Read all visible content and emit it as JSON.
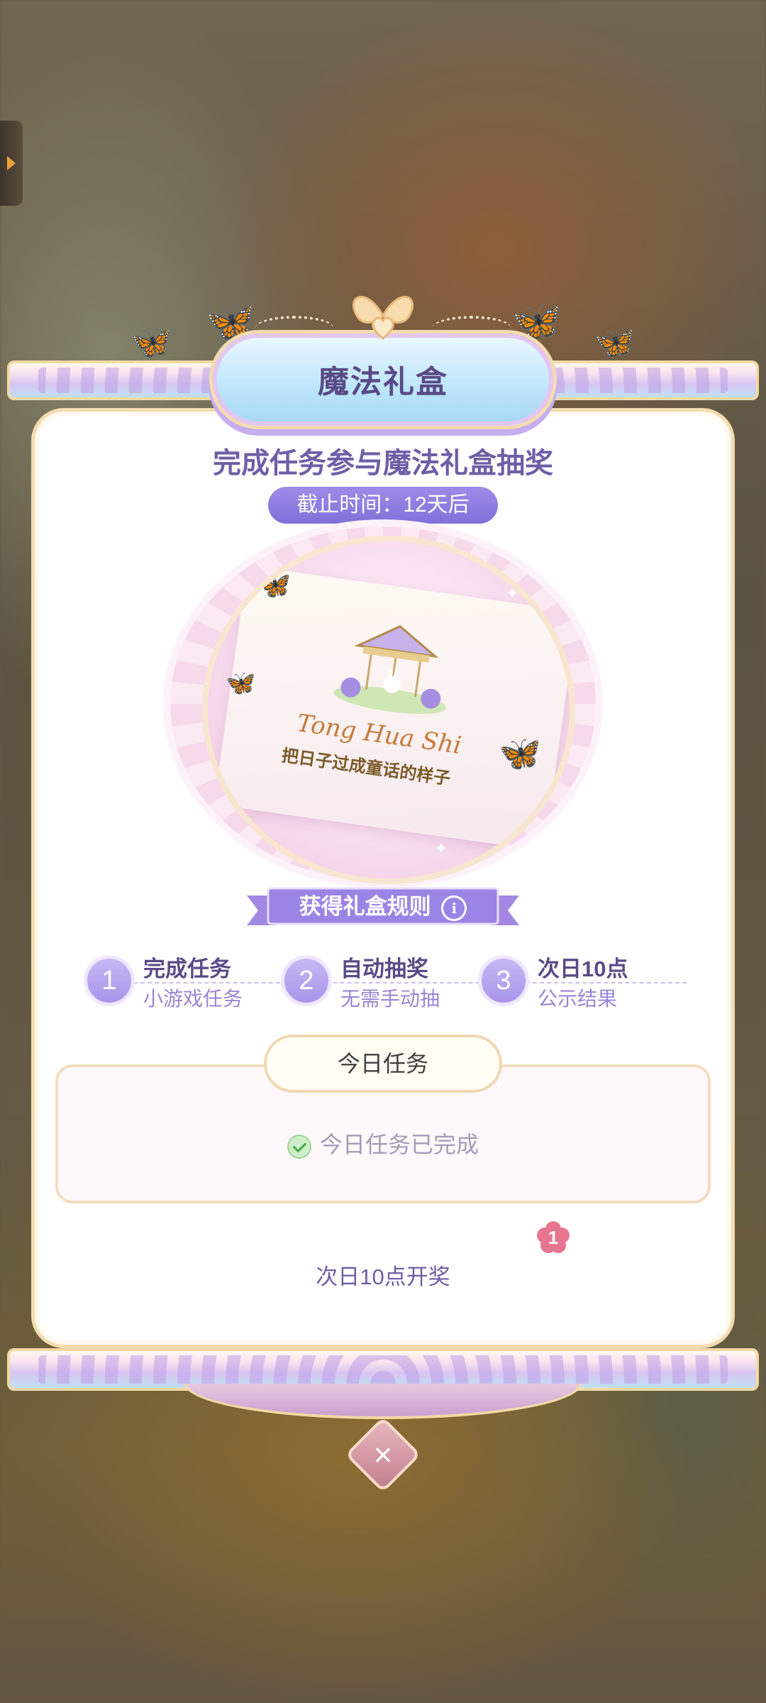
{
  "popup": {
    "title": "魔法礼盒",
    "subtitle": "完成任务参与魔法礼盒抽奖",
    "deadline": "截止时间：12天后",
    "prize": {
      "script_text": "Tong Hua Shi",
      "slogan": "把日子过成童话的样子"
    },
    "rules_label": "获得礼盒规则",
    "steps": [
      {
        "num": "1",
        "title": "完成任务",
        "subtitle": "小游戏任务"
      },
      {
        "num": "2",
        "title": "自动抽奖",
        "subtitle": "无需手动抽"
      },
      {
        "num": "3",
        "title": "次日10点",
        "subtitle": "公示结果"
      }
    ],
    "task_tab": "今日任务",
    "task_status": "今日任务已完成",
    "notice_badge": "1",
    "draw_note": "次日10点开奖"
  },
  "colors": {
    "title_text": "#5a4a86",
    "accent_purple": "#8170d9",
    "gold_border": "#f3dcb0",
    "pink_badge": "#e7758f",
    "success_green": "#4bab4a"
  }
}
